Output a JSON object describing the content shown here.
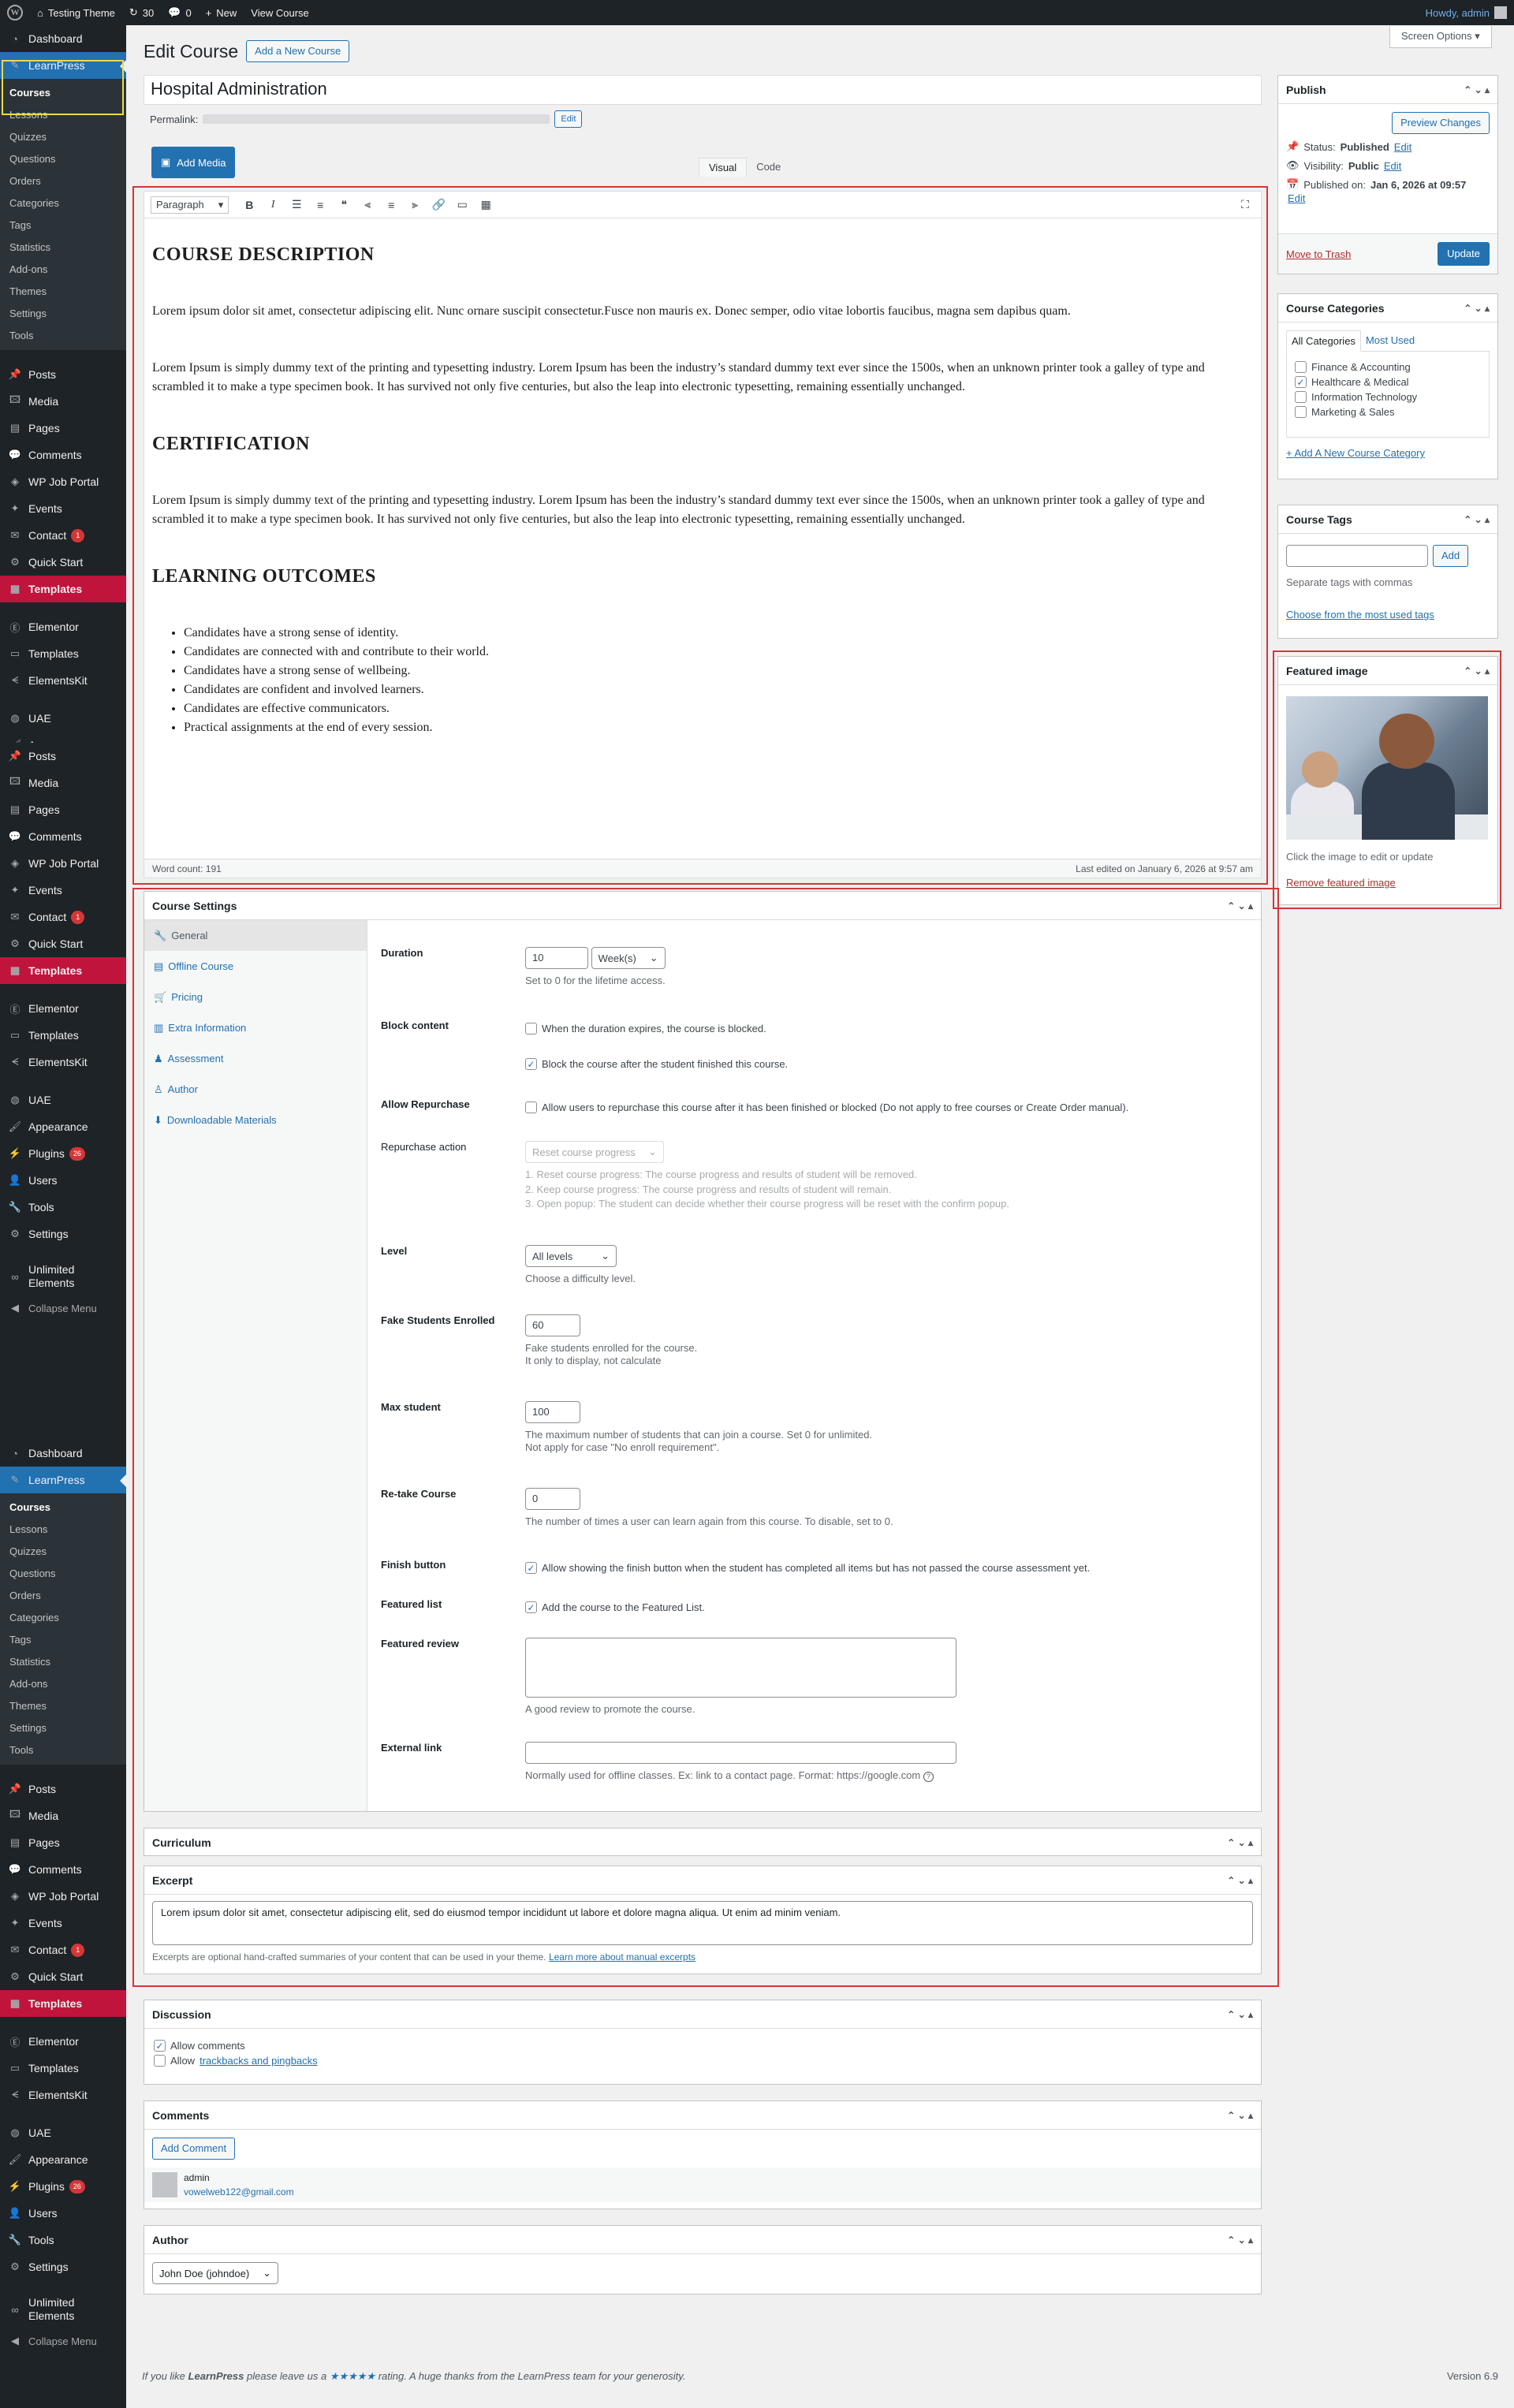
{
  "adminbar": {
    "site_name": "Testing Theme",
    "updates_count": "30",
    "comments_count": "0",
    "new_label": "New",
    "view_label": "View Course",
    "howdy": "Howdy, admin"
  },
  "menu": {
    "group1": [
      {
        "label": "Dashboard",
        "icon": "dashboard-icon"
      },
      {
        "label": "LearnPress",
        "icon": "learnpress-icon",
        "current": true
      }
    ],
    "learnpress_sub": [
      "Courses",
      "Lessons",
      "Quizzes",
      "Questions",
      "Orders",
      "Categories",
      "Tags",
      "Statistics",
      "Add-ons",
      "Themes",
      "Settings",
      "Tools"
    ],
    "group2": [
      {
        "label": "Posts",
        "icon": "pin-icon"
      },
      {
        "label": "Media",
        "icon": "media-icon"
      },
      {
        "label": "Pages",
        "icon": "page-icon"
      },
      {
        "label": "Comments",
        "icon": "comment-icon"
      },
      {
        "label": "WP Job Portal",
        "icon": "job-portal-icon"
      },
      {
        "label": "Events",
        "icon": "events-icon"
      },
      {
        "label": "Contact",
        "icon": "mail-icon",
        "badge": "1"
      },
      {
        "label": "Quick Start",
        "icon": "quick-start-icon"
      },
      {
        "label": "Templates",
        "icon": "templates-icon",
        "highlight": true
      }
    ],
    "group3": [
      {
        "label": "Elementor",
        "icon": "elementor-icon"
      },
      {
        "label": "Templates",
        "icon": "folder-icon"
      },
      {
        "label": "ElementsKit",
        "icon": "elementskit-icon"
      }
    ],
    "group4": [
      {
        "label": "UAE",
        "icon": "uae-icon"
      },
      {
        "label": "Appearance",
        "icon": "brush-icon"
      },
      {
        "label": "Plugins",
        "icon": "plug-icon",
        "badge": "26"
      },
      {
        "label": "Users",
        "icon": "users-icon"
      },
      {
        "label": "Tools",
        "icon": "wrench-icon"
      },
      {
        "label": "Settings",
        "icon": "settings-icon"
      }
    ],
    "unlimited": "Unlimited Elements",
    "collapse": "Collapse Menu"
  },
  "screen_options": "Screen Options",
  "page": {
    "title": "Edit Course",
    "add_new": "Add a New Course",
    "post_title": "Hospital Administration",
    "permalink_label": "Permalink:",
    "permalink_edit": "Edit",
    "add_media": "Add Media",
    "tab_visual": "Visual",
    "tab_code": "Code"
  },
  "editor": {
    "format": "Paragraph",
    "h1": "COURSE DESCRIPTION",
    "p1": "Lorem ipsum dolor sit amet, consectetur adipiscing elit. Nunc ornare suscipit consectetur.Fusce non mauris ex. Donec semper, odio vitae lobortis faucibus, magna sem dapibus quam.",
    "p2": "Lorem Ipsum is simply dummy text of the printing and typesetting industry. Lorem Ipsum has been the industry’s standard dummy text ever since the 1500s, when an unknown printer took a galley of type and scrambled it to make a type specimen book. It has survived not only five centuries, but also the leap into electronic typesetting, remaining essentially unchanged.",
    "h2": "CERTIFICATION",
    "p3": "Lorem Ipsum is simply dummy text of the printing and typesetting industry. Lorem Ipsum has been the industry’s standard dummy text ever since the 1500s, when an unknown printer took a galley of type and scrambled it to make a type specimen book. It has survived not only five centuries, but also the leap into electronic typesetting, remaining essentially unchanged.",
    "h3": "LEARNING OUTCOMES",
    "outcomes": [
      "Candidates have a strong sense of identity.",
      "Candidates are connected with and contribute to their world.",
      "Candidates have a strong sense of wellbeing.",
      "Candidates are confident and involved learners.",
      "Candidates are effective communicators.",
      "Practical assignments at the end of every session."
    ],
    "word_count": "Word count: 191",
    "last_edited": "Last edited on January 6, 2026 at 9:57 am"
  },
  "publish": {
    "title": "Publish",
    "preview": "Preview Changes",
    "status_label": "Status:",
    "status_value": "Published",
    "visibility_label": "Visibility:",
    "visibility_value": "Public",
    "published_label": "Published on:",
    "published_value": "Jan 6, 2026 at 09:57",
    "edit": "Edit",
    "trash": "Move to Trash",
    "update": "Update"
  },
  "categories": {
    "title": "Course Categories",
    "tab_all": "All Categories",
    "tab_used": "Most Used",
    "items": [
      {
        "label": "Finance & Accounting",
        "checked": false
      },
      {
        "label": "Healthcare & Medical",
        "checked": true
      },
      {
        "label": "Information Technology",
        "checked": false
      },
      {
        "label": "Marketing & Sales",
        "checked": false
      }
    ],
    "add_new": "+ Add A New Course Category"
  },
  "tags": {
    "title": "Course Tags",
    "add": "Add",
    "hint": "Separate tags with commas",
    "choose": "Choose from the most used tags"
  },
  "featured": {
    "title": "Featured image",
    "hint": "Click the image to edit or update",
    "remove": "Remove featured image"
  },
  "course_settings": {
    "title": "Course Settings",
    "tabs": [
      {
        "label": "General",
        "icon": "wrench-icon"
      },
      {
        "label": "Offline Course",
        "icon": "offline-icon"
      },
      {
        "label": "Pricing",
        "icon": "cart-icon"
      },
      {
        "label": "Extra Information",
        "icon": "info-icon"
      },
      {
        "label": "Assessment",
        "icon": "assessment-icon"
      },
      {
        "label": "Author",
        "icon": "author-icon"
      },
      {
        "label": "Downloadable Materials",
        "icon": "download-icon"
      }
    ],
    "duration": {
      "label": "Duration",
      "value": "10",
      "unit": "Week(s)",
      "desc": "Set to 0 for the lifetime access."
    },
    "block": {
      "label": "Block content",
      "opt1": "When the duration expires, the course is blocked.",
      "opt2": "Block the course after the student finished this course."
    },
    "repurchase": {
      "label": "Allow Repurchase",
      "opt": "Allow users to repurchase this course after it has been finished or blocked (Do not apply to free courses or Create Order manual)."
    },
    "repurchase_action": {
      "label": "Repurchase action",
      "value": "Reset course progress",
      "l1": "1. Reset course progress: The course progress and results of student will be removed.",
      "l2": "2. Keep course progress: The course progress and results of student will remain.",
      "l3": "3. Open popup: The student can decide whether their course progress will be reset with the confirm popup."
    },
    "level": {
      "label": "Level",
      "value": "All levels",
      "desc": "Choose a difficulty level."
    },
    "fake": {
      "label": "Fake Students Enrolled",
      "value": "60",
      "desc1": "Fake students enrolled for the course.",
      "desc2": "It only to display, not calculate"
    },
    "max": {
      "label": "Max student",
      "value": "100",
      "desc1": "The maximum number of students that can join a course. Set 0 for unlimited.",
      "desc2": "Not apply for case \"No enroll requirement\"."
    },
    "retake": {
      "label": "Re-take Course",
      "value": "0",
      "desc": "The number of times a user can learn again from this course. To disable, set to 0."
    },
    "finish": {
      "label": "Finish button",
      "opt": "Allow showing the finish button when the student has completed all items but has not passed the course assessment yet."
    },
    "featured_list": {
      "label": "Featured list",
      "opt": "Add the course to the Featured List."
    },
    "review": {
      "label": "Featured review",
      "desc": "A good review to promote the course."
    },
    "external": {
      "label": "External link",
      "desc": "Normally used for offline classes. Ex: link to a contact page. Format: https://google.com"
    }
  },
  "curriculum": {
    "title": "Curriculum"
  },
  "excerpt": {
    "title": "Excerpt",
    "value": "Lorem ipsum dolor sit amet, consectetur adipiscing elit, sed do eiusmod tempor incididunt ut labore et dolore magna aliqua. Ut enim ad minim veniam.",
    "hint": "Excerpts are optional hand-crafted summaries of your content that can be used in your theme.",
    "link": "Learn more about manual excerpts"
  },
  "discussion": {
    "title": "Discussion",
    "allow_comments": "Allow comments",
    "allow_pre": "Allow",
    "trackbacks": "trackbacks and pingbacks"
  },
  "comments": {
    "title": "Comments",
    "add": "Add Comment",
    "author": "admin",
    "email": "vowelweb122@gmail.com"
  },
  "author": {
    "title": "Author",
    "value": "John Doe (johndoe)"
  },
  "footer": {
    "pre": "If you like",
    "brand": "LearnPress",
    "mid": "please leave us a",
    "stars": "★★★★★",
    "post": "rating. A huge thanks from the LearnPress team for your generosity.",
    "version": "Version 6.9"
  }
}
